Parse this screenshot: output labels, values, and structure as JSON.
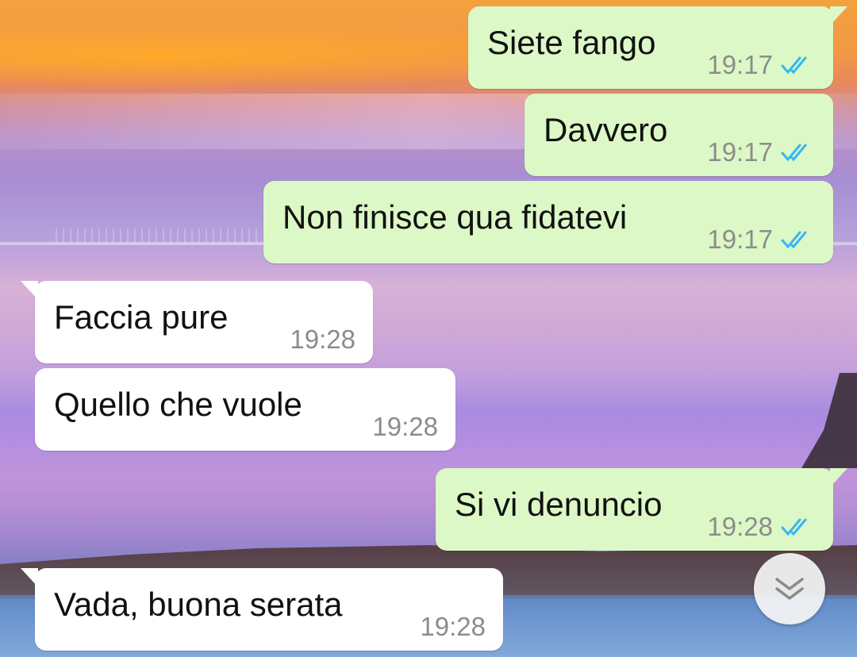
{
  "chat": {
    "messages": [
      {
        "direction": "outgoing",
        "text": "Siete fango",
        "time": "19:17",
        "status": "read"
      },
      {
        "direction": "outgoing",
        "text": "Davvero",
        "time": "19:17",
        "status": "read"
      },
      {
        "direction": "outgoing",
        "text": "Non finisce qua fidatevi",
        "time": "19:17",
        "status": "read"
      },
      {
        "direction": "incoming",
        "text": "Faccia pure",
        "time": "19:28"
      },
      {
        "direction": "incoming",
        "text": "Quello che vuole",
        "time": "19:28"
      },
      {
        "direction": "outgoing",
        "text": "Si vi denuncio",
        "time": "19:28",
        "status": "read"
      },
      {
        "direction": "incoming",
        "text": "Vada, buona serata",
        "time": "19:28"
      }
    ],
    "scroll_button_icon": "double-chevron-down-icon",
    "colors": {
      "outgoing_bubble": "#dcf8c6",
      "incoming_bubble": "#ffffff",
      "read_ticks": "#34b7f1",
      "timestamp": "#8c8c8c"
    }
  }
}
